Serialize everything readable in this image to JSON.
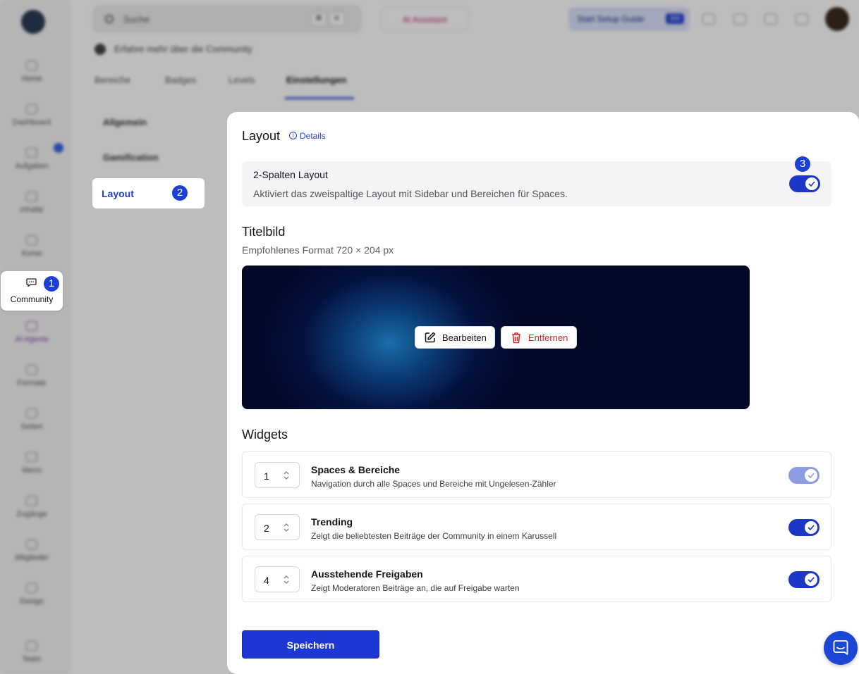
{
  "background": {
    "rail": {
      "items": [
        {
          "label": "Home"
        },
        {
          "label": "Dashboard"
        },
        {
          "label": "Aufgaben"
        },
        {
          "label": "Inhalte"
        },
        {
          "label": "Kurse"
        },
        {
          "label": "Community"
        },
        {
          "label": "AI Agents"
        },
        {
          "label": "Formate"
        },
        {
          "label": "Seiten"
        },
        {
          "label": "Menü"
        },
        {
          "label": "Zugänge"
        },
        {
          "label": "Mitglieder"
        },
        {
          "label": "Design"
        },
        {
          "label": "Team"
        }
      ]
    },
    "topbar": {
      "search_placeholder": "Suche",
      "kbd_1": "⌘",
      "kbd_2": "K",
      "ai_label": "AI Assistant",
      "setup_label": "Start Setup Guide",
      "setup_badge": "0/4"
    },
    "breadcrumb": "Erfahre mehr über die Community",
    "tabs": [
      "Bereiche",
      "Badges",
      "Levels",
      "Einstellungen"
    ],
    "sub_nav": [
      "Allgemein",
      "Gamification"
    ]
  },
  "sidebar_highlight": {
    "label": "Community",
    "step": "1"
  },
  "subnav_highlight": {
    "label": "Layout",
    "step": "2"
  },
  "panel": {
    "title": "Layout",
    "details_link": "Details",
    "two_column": {
      "title": "2-Spalten Layout",
      "description": "Aktiviert das zweispaltige Layout mit Sidebar und Bereichen für Spaces.",
      "enabled": true,
      "step": "3"
    },
    "cover": {
      "title": "Titelbild",
      "hint": "Empfohlenes Format 720 × 204 px",
      "edit_label": "Bearbeiten",
      "remove_label": "Entfernen"
    },
    "widgets": {
      "title": "Widgets",
      "items": [
        {
          "order": "1",
          "title": "Spaces & Bereiche",
          "description": "Navigation durch alle Spaces und Bereiche mit Ungelesen-Zähler",
          "enabled": true,
          "locked": true
        },
        {
          "order": "2",
          "title": "Trending",
          "description": "Zeigt die beliebtesten Beiträge der Community in einem Karussell",
          "enabled": true,
          "locked": false
        },
        {
          "order": "4",
          "title": "Ausstehende Freigaben",
          "description": "Zeigt Moderatoren Beiträge an, die auf Freigabe warten",
          "enabled": true,
          "locked": false
        }
      ]
    },
    "save_label": "Speichern"
  },
  "colors": {
    "accent": "#1c37c8",
    "danger": "#d42424",
    "overlay": "rgba(0,0,0,0.26)"
  }
}
